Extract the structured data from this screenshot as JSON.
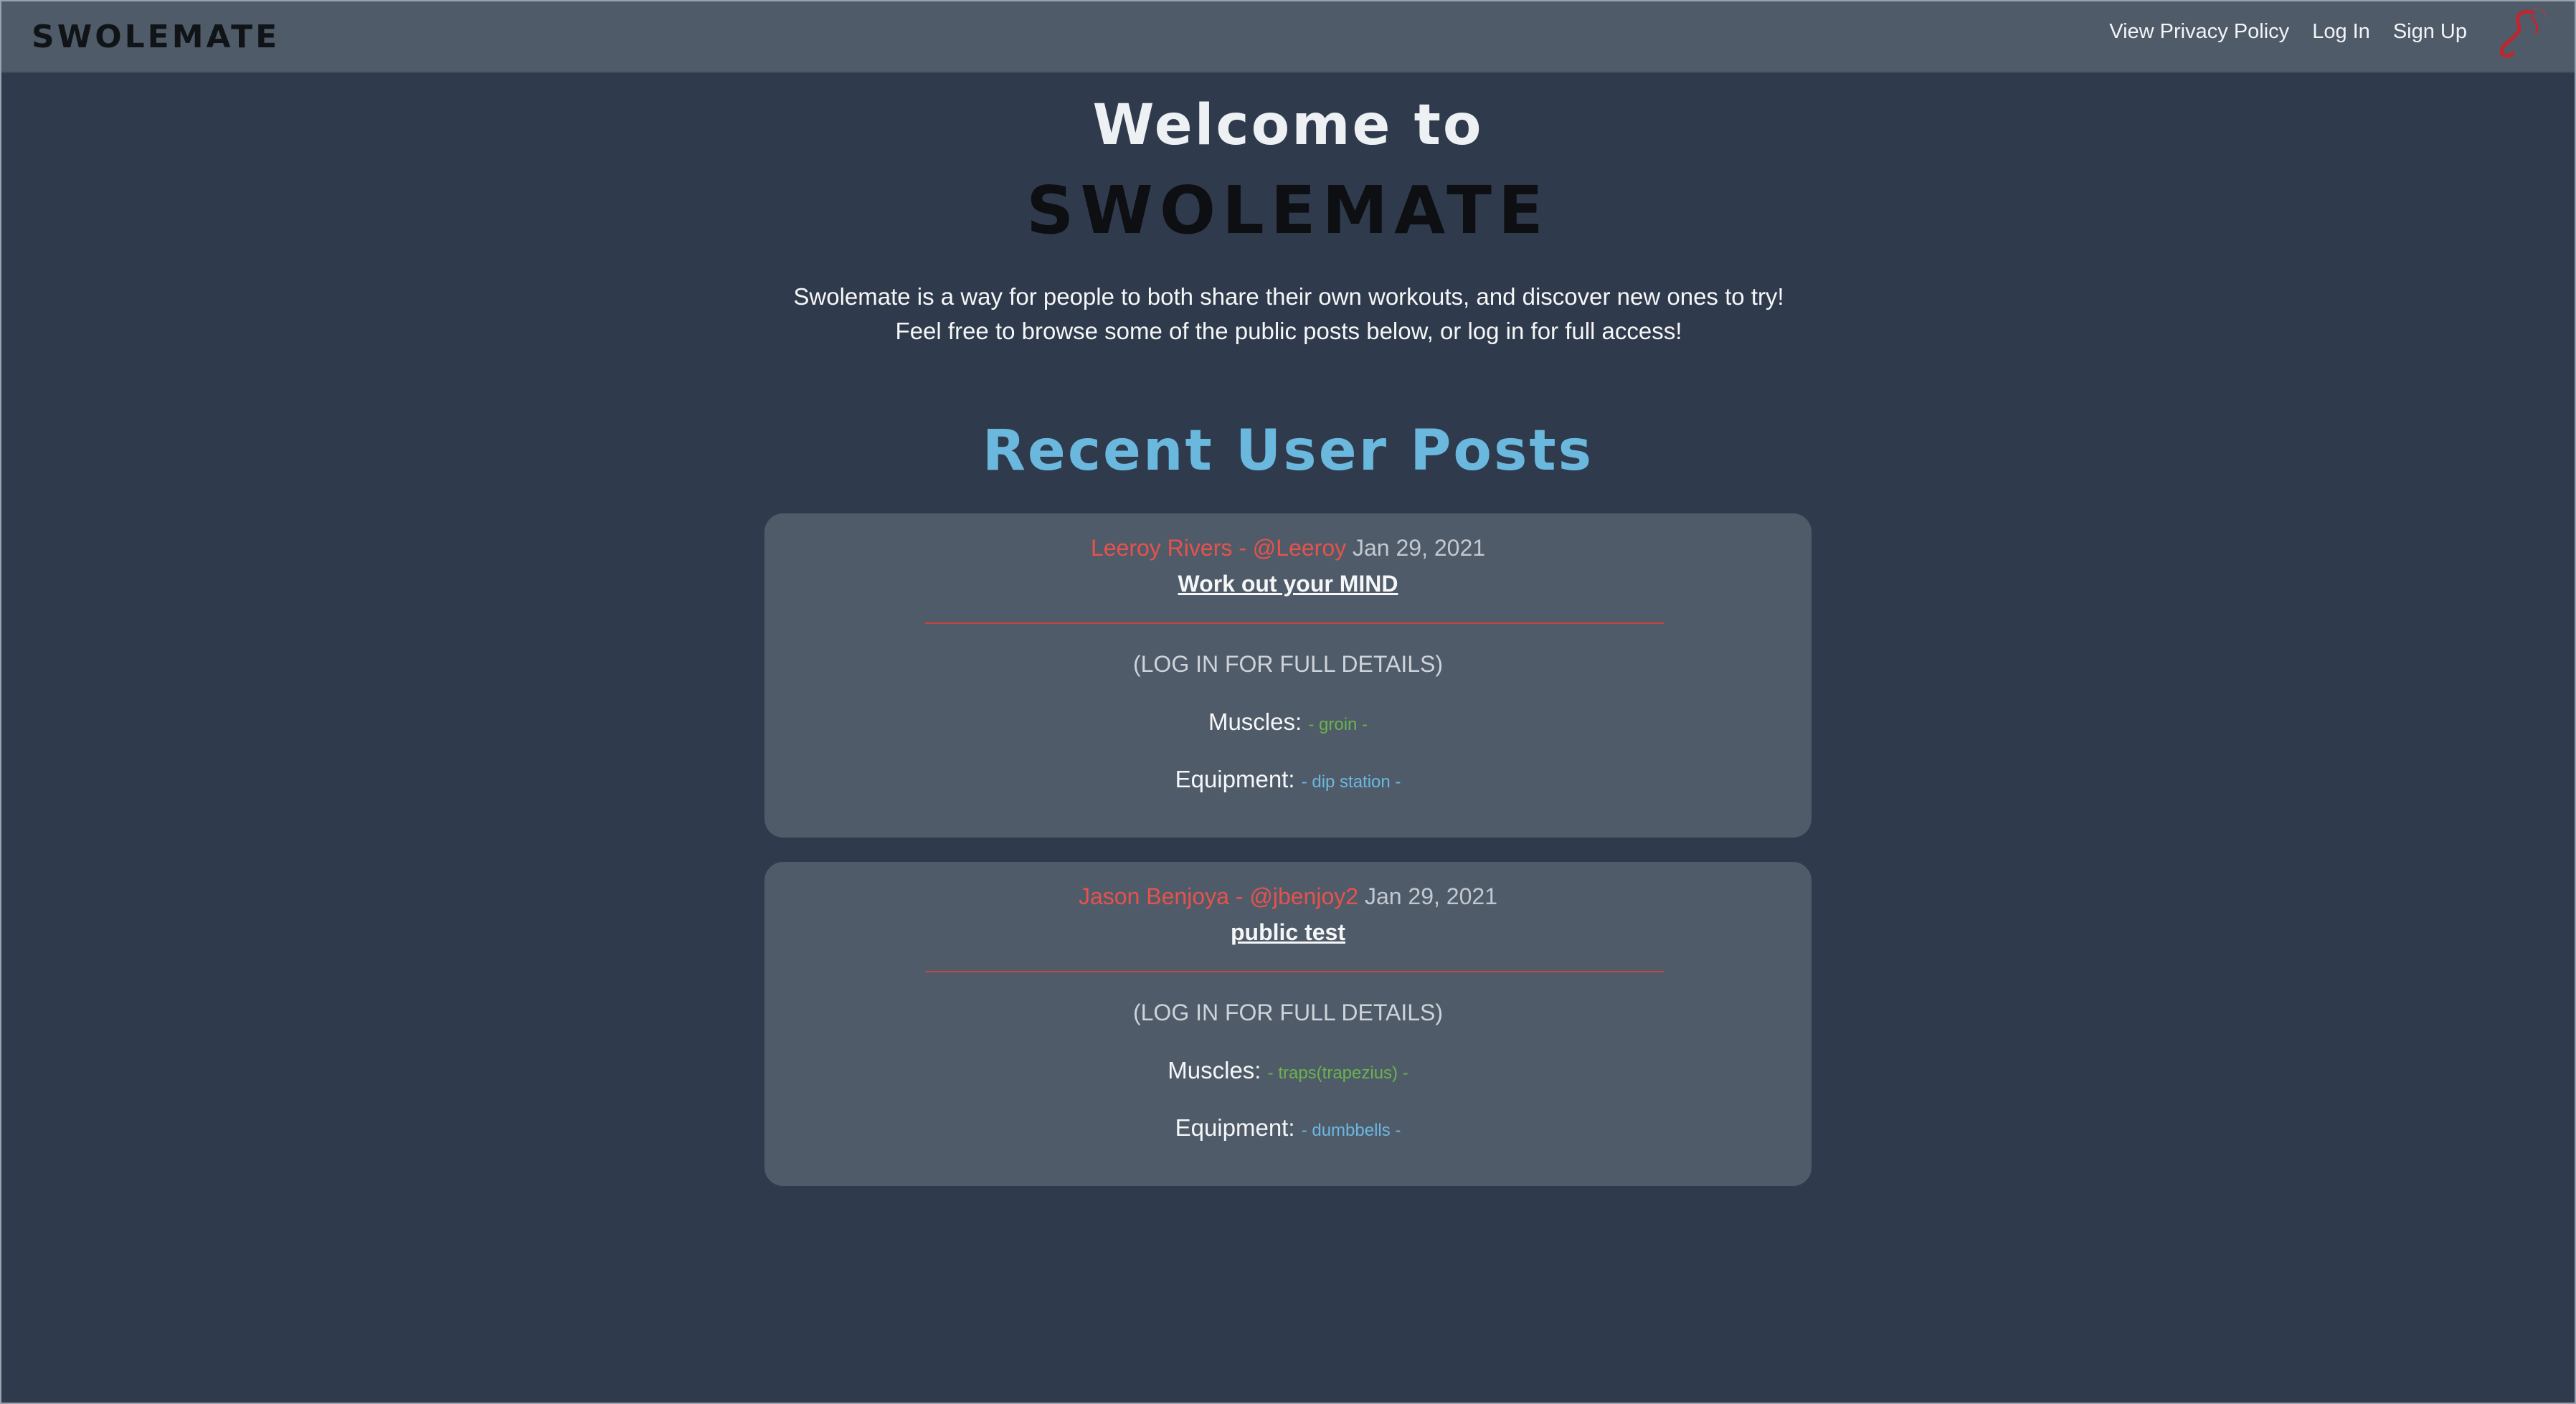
{
  "navbar": {
    "brand": "SWOLEMATE",
    "links": [
      "View Privacy Policy",
      "Log In",
      "Sign Up"
    ]
  },
  "hero": {
    "welcome": "Welcome to",
    "brand": "SWOLEMATE",
    "intro": "Swolemate is a way for people to both share their own workouts, and discover new ones to try! Feel free to browse some of the public posts below, or log in for full access!"
  },
  "section_title": "Recent User Posts",
  "labels": {
    "muscles": "Muscles:",
    "equipment": "Equipment:"
  },
  "posts": [
    {
      "author": "Leeroy Rivers - @Leeroy",
      "date": "Jan 29, 2021",
      "title": "Work out your MIND",
      "notice": "(LOG IN FOR FULL DETAILS)",
      "muscles": "- groin -",
      "equipment": "- dip station -"
    },
    {
      "author": "Jason Benjoya - @jbenjoy2",
      "date": "Jan 29, 2021",
      "title": "public test",
      "notice": "(LOG IN FOR FULL DETAILS)",
      "muscles": "- traps(trapezius) -",
      "equipment": "- dumbbells -"
    }
  ],
  "colors": {
    "background": "#2f3b4c",
    "card": "#505b6a",
    "author": "#e5534b",
    "muscle_tag": "#69b44c",
    "equipment_tag": "#6bb8df",
    "section_title": "#6bb8df"
  },
  "icons": {
    "nav_logo": "swolemate-logo-icon"
  }
}
